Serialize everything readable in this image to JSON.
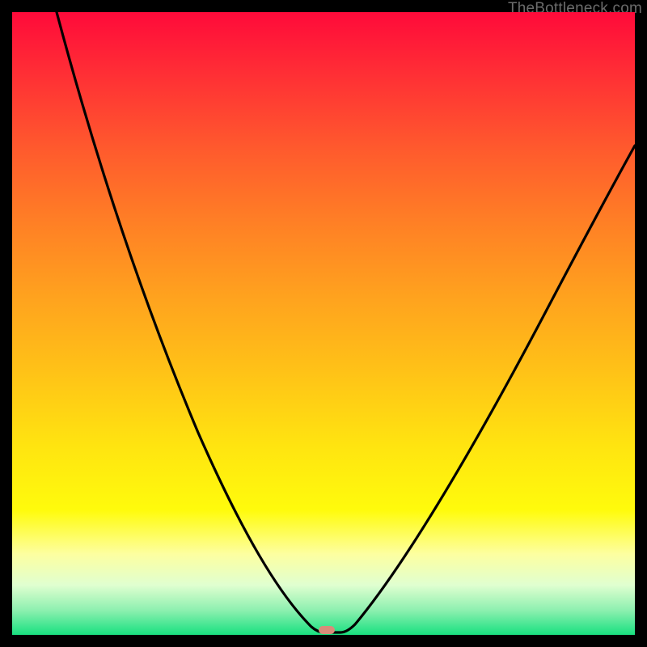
{
  "watermark": {
    "text": "TheBottleneck.com"
  },
  "marker": {
    "x_fraction_of_plot": 0.505,
    "y_fraction_of_plot": 0.992,
    "color": "#d98c7a"
  },
  "chart_data": {
    "type": "line",
    "title": "",
    "xlabel": "",
    "ylabel": "",
    "xlim": [
      0,
      100
    ],
    "ylim": [
      0,
      100
    ],
    "grid": false,
    "legend": false,
    "note": "No axes, ticks, or labels are rendered in the image. Only a black V-shaped curve over a rainbow gradient and a small marker near the minimum. Curve values below estimate vertical position of the black line from the top (0) to bottom (100) at sampled x-fractions across the plot width.",
    "series": [
      {
        "name": "bottleneck-curve",
        "x": [
          0.0,
          5.0,
          10.0,
          15.0,
          20.0,
          25.0,
          30.0,
          35.0,
          40.0,
          45.0,
          47.5,
          50.0,
          52.5,
          55.0,
          60.0,
          65.0,
          70.0,
          75.0,
          80.0,
          85.0,
          90.0,
          95.0,
          100.0
        ],
        "values": [
          0.0,
          13.0,
          25.0,
          36.0,
          46.0,
          55.0,
          64.0,
          73.0,
          82.0,
          91.0,
          96.0,
          99.5,
          99.5,
          96.0,
          89.0,
          81.0,
          73.0,
          65.0,
          56.0,
          47.0,
          38.0,
          29.0,
          20.0
        ]
      }
    ]
  }
}
